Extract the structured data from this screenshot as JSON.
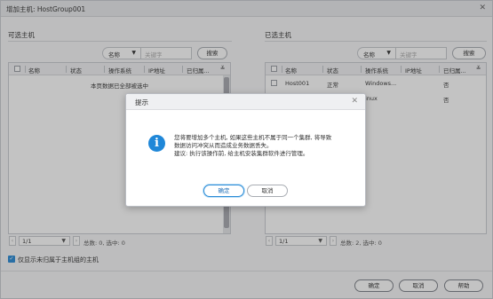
{
  "window": {
    "title": "增加主机: HostGroup001",
    "close_glyph": "✕"
  },
  "left_panel": {
    "title": "可选主机",
    "filter_field": "名称",
    "search_placeholder": "关键字",
    "search_button": "搜索",
    "columns": [
      "名称",
      "状态",
      "操作系统",
      "IP地址",
      "已归属..."
    ],
    "empty_message": "本页数据已全部被选中",
    "pager": {
      "page": "1/1",
      "summary": "总数: 0, 选中: 0"
    }
  },
  "right_panel": {
    "title": "已选主机",
    "filter_field": "名称",
    "search_placeholder": "关键字",
    "search_button": "搜索",
    "columns": [
      "名称",
      "状态",
      "操作系统",
      "IP地址",
      "已归属..."
    ],
    "rows": [
      {
        "name": "Host001",
        "status": "正常",
        "os": "Windows...",
        "ip": "",
        "assigned": "否"
      },
      {
        "name": "",
        "status": "",
        "os": "inux",
        "ip": "",
        "assigned": "否"
      }
    ],
    "pager": {
      "page": "1/1",
      "summary": "总数: 2, 选中: 0"
    }
  },
  "option": {
    "label": "仅显示未归属于主机组的主机",
    "checked": true
  },
  "footer": {
    "ok": "确定",
    "cancel": "取消",
    "help": "帮助"
  },
  "dialog": {
    "title": "提示",
    "close_glyph": "✕",
    "icon": "info-icon",
    "message_lines": [
      "您将要增加多个主机, 如果这些主机不属于同一个集群, 将导致",
      "数据访问冲突从而造成业务数据丢失。",
      "建议: 执行该操作前, 给主机安装集群软件进行管理。"
    ],
    "ok": "确定",
    "cancel": "取消"
  },
  "colors": {
    "accent": "#2a8bd6",
    "overlay": "rgba(40,40,40,0.28)"
  }
}
